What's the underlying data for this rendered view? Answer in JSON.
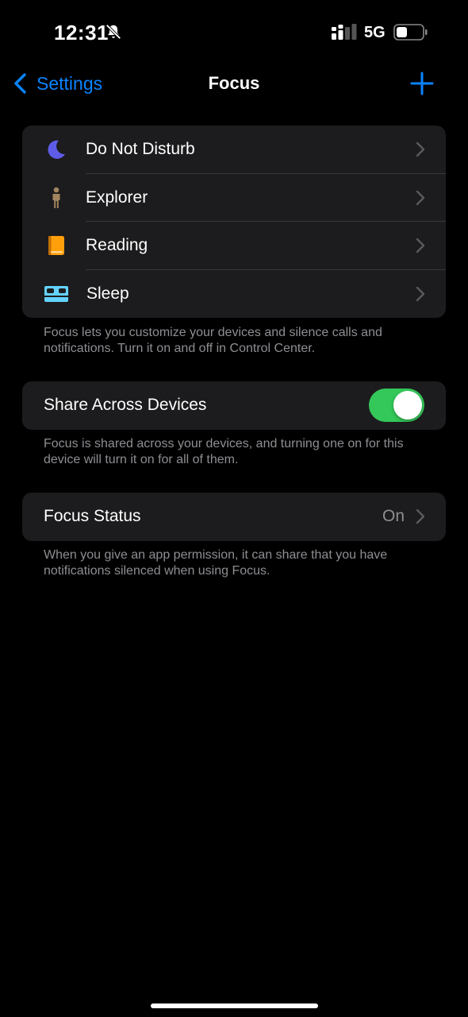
{
  "status_bar": {
    "time": "12:31",
    "network": "5G",
    "icons": [
      "bell-slash-icon",
      "signal-icon",
      "battery-icon"
    ]
  },
  "nav": {
    "back_label": "Settings",
    "title": "Focus",
    "add_icon": "plus-icon"
  },
  "focus_modes": [
    {
      "label": "Do Not Disturb",
      "icon": "moon-icon",
      "color": "#5e5ce6"
    },
    {
      "label": "Explorer",
      "icon": "person-icon",
      "color": "#a2845e"
    },
    {
      "label": "Reading",
      "icon": "book-icon",
      "color": "#ff9f0a"
    },
    {
      "label": "Sleep",
      "icon": "bed-icon",
      "color": "#64d2ff"
    }
  ],
  "focus_footnote": "Focus lets you customize your devices and silence calls and notifications. Turn it on and off in Control Center.",
  "share": {
    "label": "Share Across Devices",
    "enabled": true,
    "toggle_color": "#34c759",
    "footnote": "Focus is shared across your devices, and turning one on for this device will turn it on for all of them."
  },
  "status": {
    "label": "Focus Status",
    "value": "On",
    "footnote": "When you give an app permission, it can share that you have notifications silenced when using Focus."
  },
  "colors": {
    "accent": "#0a84ff",
    "background": "#000000",
    "cell": "#1c1c1e",
    "secondary_text": "#8e8e93"
  }
}
